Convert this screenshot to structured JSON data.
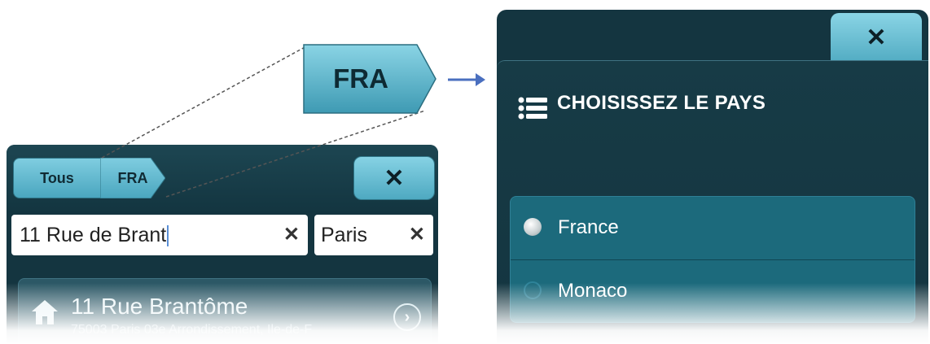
{
  "left_screen": {
    "crumbs": [
      "Tous",
      "FRA"
    ],
    "close_label": "✕",
    "street_input": {
      "value": "11 Rue de Brant",
      "clear": "✕"
    },
    "city_input": {
      "value": "Paris",
      "clear": "✕"
    },
    "result": {
      "title": "11 Rue Brantôme",
      "subtitle": "75003 Paris 03e Arrondissement, Ile-de-F",
      "chevron": "›"
    }
  },
  "callout": {
    "label": "FRA",
    "arrow": "→"
  },
  "right_screen": {
    "close_label": "✕",
    "title": "CHOISISSEZ LE PAYS",
    "options": [
      {
        "label": "France",
        "selected": true
      },
      {
        "label": "Monaco",
        "selected": false
      }
    ]
  },
  "colors": {
    "panel_bg": "#143540",
    "button_accent": "#6fc3d8",
    "options_bg": "#1c6a7c",
    "arrow": "#4a6fbf"
  },
  "icons": [
    "close-icon",
    "home-icon",
    "chevron-right-icon",
    "list-icon",
    "radio-icon",
    "arrow-right-icon"
  ]
}
